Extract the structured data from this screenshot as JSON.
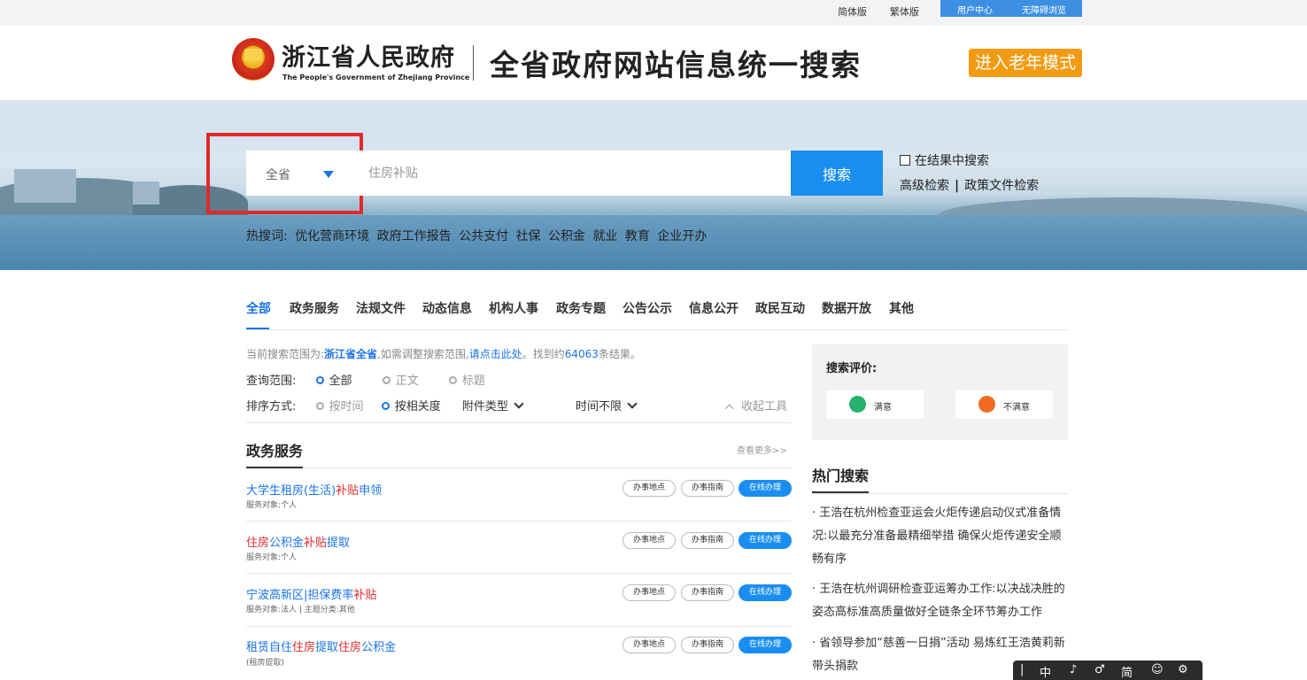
{
  "topbar": {
    "simplified": "简体版",
    "traditional": "繁体版",
    "user_center": "用户中心",
    "accessible": "无障碍浏览"
  },
  "header": {
    "logo_cn": "浙江省人民政府",
    "logo_en": "The People's Government of Zhejiang Province",
    "title": "全省政府网站信息统一搜索",
    "elder_mode": "进入老年模式"
  },
  "search": {
    "scope_label": "全省",
    "placeholder": "住房补贴",
    "button": "搜索",
    "in_result": "在结果中搜索",
    "advanced": "高级检索",
    "policy": "政策文件检索",
    "hot_label": "热搜词:",
    "hot_words": [
      "优化营商环境",
      "政府工作报告",
      "公共支付",
      "社保",
      "公积金",
      "就业",
      "教育",
      "企业开办"
    ]
  },
  "tabs": [
    "全部",
    "政务服务",
    "法规文件",
    "动态信息",
    "机构人事",
    "政务专题",
    "公告公示",
    "信息公开",
    "政民互动",
    "数据开放",
    "其他"
  ],
  "info": {
    "prefix": "当前搜索范围为:",
    "scope": "浙江省全省",
    "mid": ",如需调整搜索范围,",
    "link": "请点击此处",
    "suffix_a": "。找到约",
    "count": "64063",
    "suffix_b": "条结果。"
  },
  "filters": {
    "range_label": "查询范围:",
    "range_options": [
      "全部",
      "正文",
      "标题"
    ],
    "sort_label": "排序方式:",
    "sort_options": [
      "按时间",
      "按相关度"
    ],
    "attach": "附件类型",
    "time": "时间不限",
    "collapse": "收起工具"
  },
  "section": {
    "title": "政务服务",
    "more": "查看更多>>",
    "pill_location": "办事地点",
    "pill_guide": "办事指南",
    "pill_online": "在线办理",
    "rows": [
      {
        "pre": "大学生租房(生活)",
        "hl": "补贴",
        "post": "申领",
        "sub": "服务对象:个人"
      },
      {
        "pre": "",
        "hl": "住房",
        "mid": "公积金",
        "hl2": "补贴",
        "post": "提取",
        "sub": "服务对象:个人"
      },
      {
        "pre": "宁波高新区|担保费率",
        "hl": "补贴",
        "post": "",
        "sub": "服务对象:法人 | 主题分类:其他"
      },
      {
        "pre": "租赁自住",
        "hl": "住房",
        "mid": "提取",
        "hl2": "住房",
        "post": "公积金",
        "sub": "(租房提取)"
      }
    ]
  },
  "evaluation": {
    "title": "搜索评价:",
    "satisfied": "满意",
    "unsatisfied": "不满意"
  },
  "hot_search": {
    "title": "热门搜索",
    "items": [
      "· 王浩在杭州检查亚运会火炬传递启动仪式准备情况:以最充分准备最精细举措 确保火炬传递安全顺畅有序",
      "· 王浩在杭州调研检查亚运筹办工作:以决战决胜的姿态高标准高质量做好全链条全环节筹办工作",
      "· 省领导参加“慈善一日捐”活动 易炼红王浩黄莉新带头捐款"
    ]
  },
  "toolbar": {
    "items": [
      "|",
      "中",
      "♪",
      "♂",
      "简",
      "☺",
      "⚙"
    ]
  }
}
